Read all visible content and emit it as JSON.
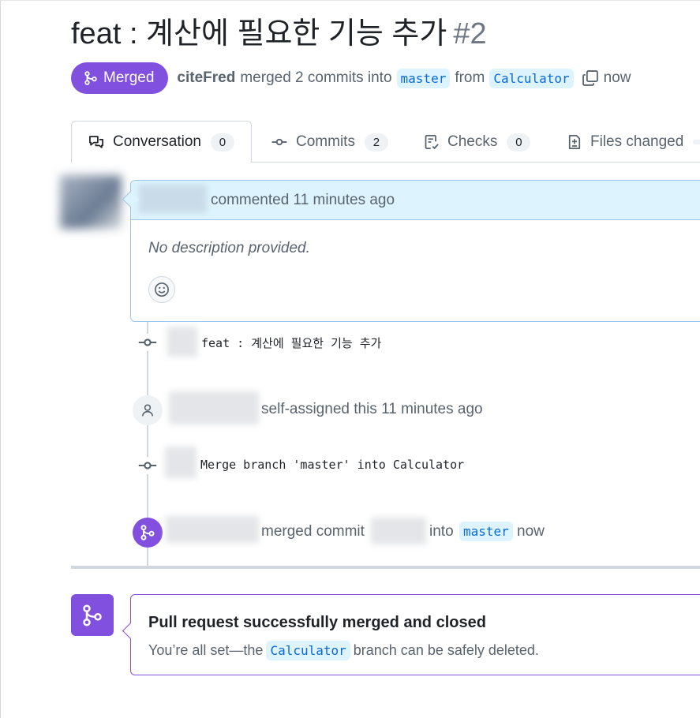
{
  "pr": {
    "title": "feat : 계산에 필요한 기능 추가",
    "number": "#2",
    "status_badge": "Merged",
    "author": "citeFred",
    "merged_text": "merged 2 commits into",
    "base_branch": "master",
    "from_text": "from",
    "head_branch": "Calculator",
    "time": "now"
  },
  "tabs": [
    {
      "label": "Conversation",
      "count": "0",
      "icon": "comment-discussion-icon"
    },
    {
      "label": "Commits",
      "count": "2",
      "icon": "git-commit-icon"
    },
    {
      "label": "Checks",
      "count": "0",
      "icon": "checklist-icon"
    },
    {
      "label": "Files changed",
      "count": "",
      "icon": "file-diff-icon"
    }
  ],
  "comment": {
    "action": "commented 11 minutes ago",
    "body": "No description provided.",
    "reaction_icon": "smiley-icon"
  },
  "timeline": [
    {
      "type": "commit",
      "message": "feat : 계산에 필요한 기능 추가"
    },
    {
      "type": "event",
      "text": "self-assigned this 11 minutes ago"
    },
    {
      "type": "commit",
      "message": "Merge branch 'master' into Calculator"
    },
    {
      "type": "merge",
      "prefix": "merged commit",
      "into": "into",
      "branch": "master",
      "time": "now"
    }
  ],
  "merged_box": {
    "heading": "Pull request successfully merged and closed",
    "sub_prefix": "You’re all set—the",
    "branch": "Calculator",
    "sub_suffix": "branch can be safely deleted."
  },
  "colors": {
    "merged_purple": "#8250df",
    "link_blue": "#0969da",
    "branch_bg": "#ddf4ff"
  }
}
